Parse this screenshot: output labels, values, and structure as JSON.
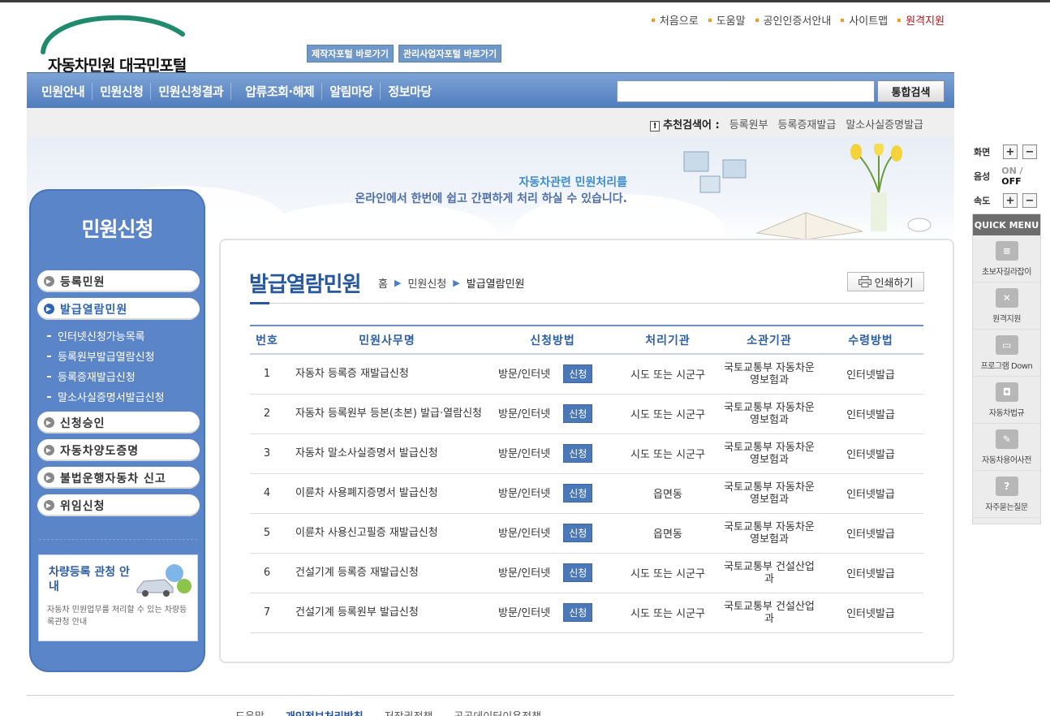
{
  "logo": {
    "text": "자동차민원 대국민포털"
  },
  "portal_links": [
    "제작자포털 바로가기",
    "관리사업자포털 바로가기"
  ],
  "util_links": [
    "처음으로",
    "도움말",
    "공인인증서안내",
    "사이트맵",
    "원격지원"
  ],
  "nav": [
    "민원안내",
    "민원신청",
    "민원신청결과",
    "압류조회·해제",
    "알림마당",
    "정보마당"
  ],
  "search": {
    "button": "통합검색",
    "placeholder": ""
  },
  "recommend": {
    "label": "추천검색어 :",
    "terms": [
      "등록원부",
      "등록증재발급",
      "말소사실증명발급"
    ]
  },
  "banner": {
    "line1": "자동차관련 민원처리를",
    "line2": "온라인에서 한번에 쉽고 간편하게 처리 하실 수 있습니다."
  },
  "lnb": {
    "title": "민원신청",
    "items": [
      "등록민원",
      "발급열람민원"
    ],
    "sub": [
      "인터넷신청가능목록",
      "등록원부발급열람신청",
      "등록증재발급신청",
      "말소사실증명서발급신청"
    ],
    "items2": [
      "신청승인",
      "자동차양도증명",
      "불법운행자동차 신고",
      "위임신청"
    ],
    "box_title": "차량등록 관청 안내",
    "box_desc": "자동차 민원업무를 처리할 수 있는 차량등록관청 안내"
  },
  "page": {
    "title": "발급열람민원",
    "breadcrumb": [
      "홈",
      "민원신청",
      "발급열람민원"
    ],
    "print": "인쇄하기"
  },
  "table": {
    "headers": [
      "번호",
      "민원사무명",
      "신청방법",
      "처리기관",
      "소관기관",
      "수령방법"
    ],
    "apply_label": "신청",
    "rows": [
      {
        "no": "1",
        "name": "자동차 등록증 재발급신청",
        "method": "방문/인터넷",
        "proc": "시도 또는 시군구",
        "dept": "국토교통부 자동차운영보험과",
        "recv": "인터넷발급"
      },
      {
        "no": "2",
        "name": "자동차 등록원부 등본(초본) 발급·열람신청",
        "method": "방문/인터넷",
        "proc": "시도 또는 시군구",
        "dept": "국토교통부 자동차운영보험과",
        "recv": "인터넷발급"
      },
      {
        "no": "3",
        "name": "자동차 말소사실증명서 발급신청",
        "method": "방문/인터넷",
        "proc": "시도 또는 시군구",
        "dept": "국토교통부 자동차운영보험과",
        "recv": "인터넷발급"
      },
      {
        "no": "4",
        "name": "이륜차 사용폐지증명서 발급신청",
        "method": "방문/인터넷",
        "proc": "읍면동",
        "dept": "국토교통부 자동차운영보험과",
        "recv": "인터넷발급"
      },
      {
        "no": "5",
        "name": "이륜차 사용신고필증 재발급신청",
        "method": "방문/인터넷",
        "proc": "읍면동",
        "dept": "국토교통부 자동차운영보험과",
        "recv": "인터넷발급"
      },
      {
        "no": "6",
        "name": "건설기계 등록증 재발급신청",
        "method": "방문/인터넷",
        "proc": "시도 또는 시군구",
        "dept": "국토교통부 건설산업과",
        "recv": "인터넷발급"
      },
      {
        "no": "7",
        "name": "건설기계 등록원부 발급신청",
        "method": "방문/인터넷",
        "proc": "시도 또는 시군구",
        "dept": "국토교통부 건설산업과",
        "recv": "인터넷발급"
      }
    ]
  },
  "side": {
    "screen": "화면",
    "voice": "음성",
    "speed": "속도",
    "on": "ON",
    "off": "OFF",
    "quick_title": "QUICK MENU",
    "quick": [
      "초보자길라잡이",
      "원격지원",
      "프로그램 Down",
      "자동차법규",
      "자동차용어사전",
      "자주묻는질문"
    ]
  },
  "footer": [
    "도움말",
    "개인정보처리방침",
    "저작권정책",
    "공공데이터이용정책"
  ]
}
